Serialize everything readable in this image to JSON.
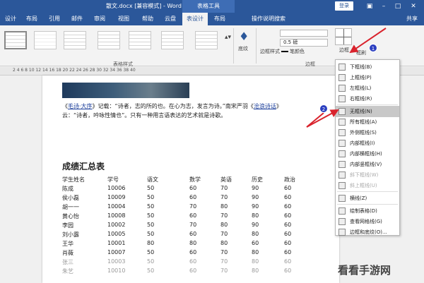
{
  "titlebar": {
    "doc_title": "散文.docx [兼容模式] - Word",
    "tools_tag": "表格工具",
    "login": "登录",
    "controls": [
      "▣",
      "–",
      "□",
      "✕"
    ]
  },
  "tabs": [
    "设计",
    "布局",
    "引用",
    "邮件",
    "审阅",
    "视图",
    "帮助",
    "云盘",
    "表设计",
    "布局",
    "操作说明搜索",
    "共享"
  ],
  "ribbon": {
    "shading_label": "底纹",
    "table_styles_label": "表格样式",
    "border_styles_label": "边框样式",
    "line_weight": "0.5 磅",
    "pen_color_label": "笔颜色",
    "borders_group_label": "边框",
    "borders_button_label": "边框",
    "painter_label": "框刷"
  },
  "ruler": "2  4  6  8  10  12  14  16  18  20  22  24  26  28  30  32  34  36  38  40",
  "document": {
    "line1_pre": "《",
    "line1_link1": "毛诗·大序",
    "line1_mid": "》记载：“诗者，志的所的也。在心为志，发言为诗。”南宋严羽《",
    "line1_link2": "沧浪诗话",
    "line1_post": "》",
    "line2": "云：“诗者，吟咏性情也”。只有一种用言语表达的艺术就是诗歌。",
    "heading": "成绩汇总表",
    "table_header": [
      "学生姓名",
      "学号",
      "语文",
      "数学",
      "英语",
      "历史",
      "政治"
    ],
    "table_rows": [
      [
        "陈成",
        "10006",
        "50",
        "60",
        "70",
        "90",
        "60"
      ],
      [
        "侯小磊",
        "10009",
        "50",
        "60",
        "70",
        "90",
        "60"
      ],
      [
        "胡一一",
        "10004",
        "50",
        "70",
        "80",
        "90",
        "60"
      ],
      [
        "黄心怡",
        "10008",
        "50",
        "60",
        "70",
        "80",
        "60"
      ],
      [
        "李园",
        "10002",
        "50",
        "70",
        "80",
        "90",
        "60"
      ],
      [
        "刘小露",
        "10005",
        "50",
        "60",
        "70",
        "80",
        "60"
      ],
      [
        "王华",
        "10001",
        "80",
        "80",
        "80",
        "60",
        "60"
      ],
      [
        "肖薇",
        "10007",
        "50",
        "60",
        "70",
        "80",
        "60"
      ],
      [
        "张三",
        "10003",
        "50",
        "60",
        "70",
        "80",
        "60"
      ],
      [
        "朱艺",
        "10010",
        "50",
        "60",
        "70",
        "80",
        "60"
      ]
    ]
  },
  "dropdown": {
    "items": [
      {
        "label": "下框线(B)",
        "enabled": true,
        "highlight": false
      },
      {
        "label": "上框线(P)",
        "enabled": true,
        "highlight": false
      },
      {
        "label": "左框线(L)",
        "enabled": true,
        "highlight": false
      },
      {
        "label": "右框线(R)",
        "enabled": true,
        "highlight": false
      },
      {
        "label": "无框线(N)",
        "enabled": true,
        "highlight": true
      },
      {
        "label": "所有框线(A)",
        "enabled": true,
        "highlight": false
      },
      {
        "label": "外侧框线(S)",
        "enabled": true,
        "highlight": false
      },
      {
        "label": "内部框线(I)",
        "enabled": true,
        "highlight": false
      },
      {
        "label": "内部横框线(H)",
        "enabled": true,
        "highlight": false
      },
      {
        "label": "内部竖框线(V)",
        "enabled": true,
        "highlight": false
      },
      {
        "label": "斜下框线(W)",
        "enabled": false,
        "highlight": false
      },
      {
        "label": "斜上框线(U)",
        "enabled": false,
        "highlight": false
      },
      {
        "label": "横线(Z)",
        "enabled": true,
        "highlight": false
      },
      {
        "label": "绘制表格(D)",
        "enabled": true,
        "highlight": false
      },
      {
        "label": "查看网格线(G)",
        "enabled": true,
        "highlight": false
      },
      {
        "label": "边框和底纹(O)...",
        "enabled": true,
        "highlight": false
      }
    ]
  },
  "markers": [
    "1",
    "2"
  ],
  "watermark": "看看手游网",
  "colors": {
    "accent": "#2b579a",
    "arrow": "#d9232d",
    "marker": "#2b3fc0"
  }
}
